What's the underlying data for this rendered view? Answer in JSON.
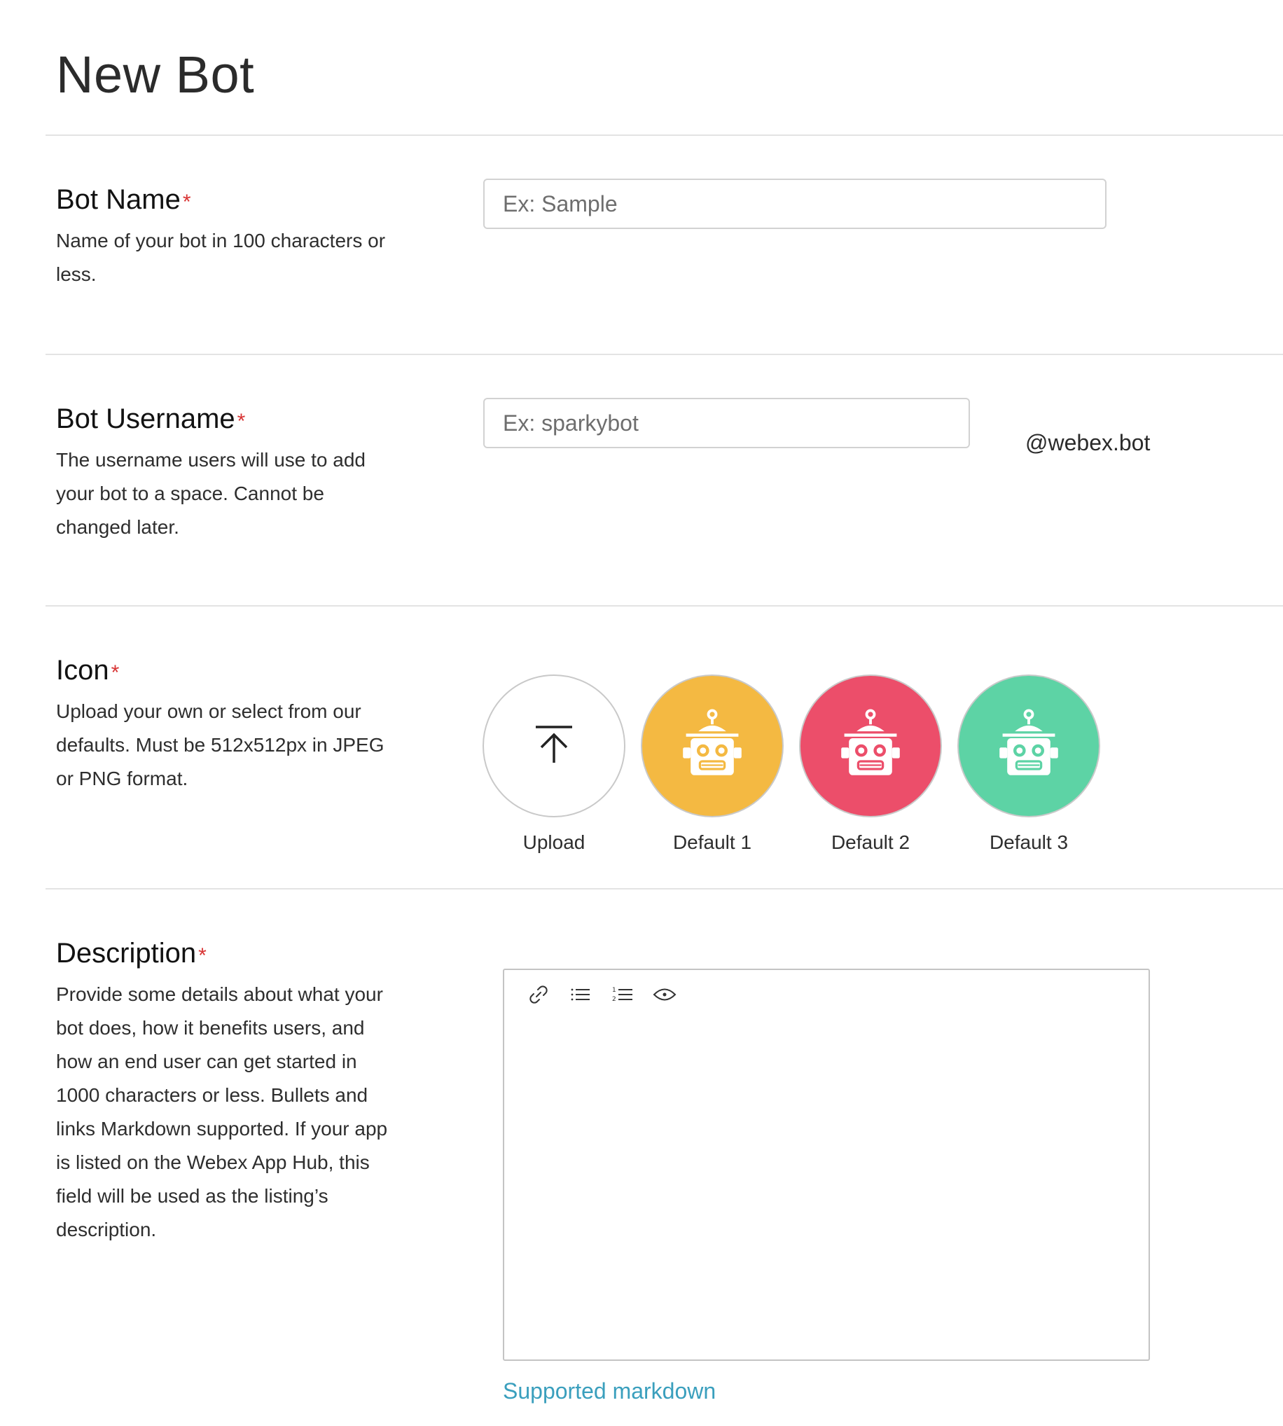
{
  "page": {
    "title": "New Bot"
  },
  "required_marker": "*",
  "bot_name": {
    "title": "Bot Name",
    "description": "Name of your bot in 100 characters or less.",
    "placeholder": "Ex: Sample",
    "value": ""
  },
  "bot_username": {
    "title": "Bot Username",
    "description": "The username users will use to add your bot to a space. Cannot be changed later.",
    "placeholder": "Ex: sparkybot",
    "value": "",
    "suffix": "@webex.bot"
  },
  "icon": {
    "title": "Icon",
    "description": "Upload your own or select from our defaults. Must be 512x512px in JPEG or PNG format.",
    "options": [
      {
        "label": "Upload",
        "icon": "upload-arrow-icon",
        "color": "#ffffff"
      },
      {
        "label": "Default 1",
        "icon": "robot-icon",
        "color": "#F4B942"
      },
      {
        "label": "Default 2",
        "icon": "robot-icon",
        "color": "#EC4E6A"
      },
      {
        "label": "Default 3",
        "icon": "robot-icon",
        "color": "#5DD3A5"
      }
    ]
  },
  "description": {
    "title": "Description",
    "description": "Provide some details about what your bot does, how it benefits users, and how an end user can get started in 1000 characters or less. Bullets and links Markdown supported. If your app is listed on the Webex App Hub, this field will be used as the listing’s description.",
    "value": "",
    "toolbar": [
      "link-icon",
      "bulleted-list-icon",
      "numbered-list-icon",
      "preview-eye-icon"
    ],
    "markdown_link": "Supported markdown"
  },
  "colors": {
    "required": "#d83434",
    "link": "#3a9fbd",
    "divider": "#e3e3e3"
  }
}
